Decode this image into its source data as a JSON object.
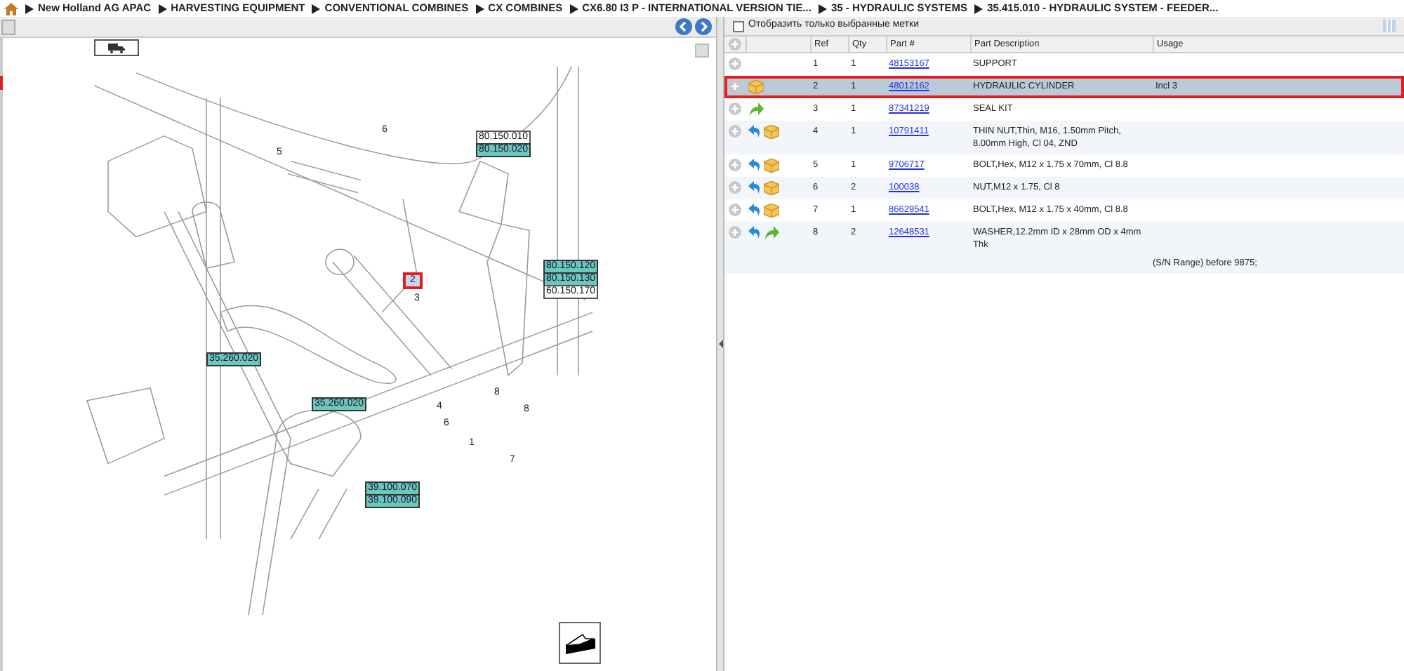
{
  "breadcrumb": [
    "New Holland AG APAC",
    "HARVESTING EQUIPMENT",
    "CONVENTIONAL COMBINES",
    "CX COMBINES",
    "CX6.80 I3 P - INTERNATIONAL VERSION TIE...",
    "35 - HYDRAULIC SYSTEMS",
    "35.415.010 - HYDRAULIC SYSTEM - FEEDER..."
  ],
  "filter": {
    "label": "Отобразить только выбранные метки",
    "checked": false
  },
  "diagram": {
    "callouts": [
      {
        "text": "80.150.010",
        "linked": false
      },
      {
        "text": "80.150.020",
        "linked": true
      },
      {
        "text": "80.150.120",
        "linked": true
      },
      {
        "text": "80.150.130",
        "linked": true
      },
      {
        "text": "60.150.170",
        "linked": false
      },
      {
        "text": "35.260.020",
        "linked": true
      },
      {
        "text": "35.260.020",
        "linked": true
      },
      {
        "text": "39.100.070",
        "linked": true
      },
      {
        "text": "39.100.090",
        "linked": true
      }
    ],
    "refs": [
      {
        "text": "5",
        "selected": false
      },
      {
        "text": "6",
        "selected": false
      },
      {
        "text": "2",
        "selected": true
      },
      {
        "text": "3",
        "selected": false
      },
      {
        "text": "4",
        "selected": false
      },
      {
        "text": "6",
        "selected": false
      },
      {
        "text": "8",
        "selected": false
      },
      {
        "text": "8",
        "selected": false
      },
      {
        "text": "1",
        "selected": false
      },
      {
        "text": "7",
        "selected": false
      }
    ]
  },
  "table": {
    "columns": [
      "Ref",
      "Qty",
      "Part #",
      "Part Description",
      "Usage"
    ],
    "rows": [
      {
        "ref": "1",
        "qty": "1",
        "part": "48153167",
        "description": "SUPPORT",
        "usage": "",
        "icons": [],
        "selected": false
      },
      {
        "ref": "2",
        "qty": "1",
        "part": "48012162",
        "description": "HYDRAULIC CYLINDER",
        "usage": "Incl 3",
        "icons": [
          {
            "kind": "box"
          }
        ],
        "selected": true
      },
      {
        "ref": "3",
        "qty": "1",
        "part": "87341219",
        "description": "SEAL KIT",
        "usage": "",
        "icons": [
          {
            "kind": "green-arrow"
          }
        ],
        "selected": false
      },
      {
        "ref": "4",
        "qty": "1",
        "part": "10791411",
        "description": "THIN NUT,Thin, M16, 1.50mm Pitch, 8.00mm High, Cl 04, ZND",
        "usage": "",
        "icons": [
          {
            "kind": "blue-arrow"
          },
          {
            "kind": "box"
          }
        ],
        "selected": false
      },
      {
        "ref": "5",
        "qty": "1",
        "part": "9706717",
        "description": "BOLT,Hex, M12 x 1.75 x 70mm, Cl 8.8",
        "usage": "",
        "icons": [
          {
            "kind": "blue-arrow"
          },
          {
            "kind": "box"
          }
        ],
        "selected": false
      },
      {
        "ref": "6",
        "qty": "2",
        "part": "100038",
        "description": "NUT,M12 x 1.75, Cl 8",
        "usage": "",
        "icons": [
          {
            "kind": "blue-arrow"
          },
          {
            "kind": "box"
          }
        ],
        "selected": false
      },
      {
        "ref": "7",
        "qty": "1",
        "part": "86629541",
        "description": "BOLT,Hex, M12 x 1.75 x 40mm, Cl 8.8",
        "usage": "",
        "icons": [
          {
            "kind": "blue-arrow"
          },
          {
            "kind": "box"
          }
        ],
        "selected": false
      },
      {
        "ref": "8",
        "qty": "2",
        "part": "12648531",
        "description": "WASHER,12.2mm ID x 28mm OD x 4mm Thk",
        "usage": "",
        "icons": [
          {
            "kind": "blue-arrow"
          },
          {
            "kind": "green-arrow"
          }
        ],
        "selected": false
      }
    ],
    "note": "(S/N Range) before 9875;"
  }
}
